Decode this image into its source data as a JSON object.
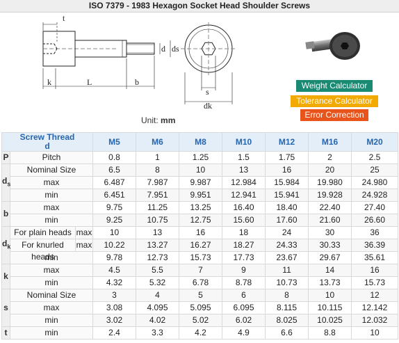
{
  "title": "ISO 7379 - 1983 Hexagon Socket Head Shoulder Screws",
  "drawing": {
    "dim_labels": [
      "t",
      "k",
      "L",
      "b",
      "d",
      "ds",
      "s",
      "dk"
    ]
  },
  "unit": {
    "label": "Unit:",
    "value": "mm"
  },
  "buttons": {
    "weight": "Weight Calculator",
    "tolerance": "Tolerance Calculator",
    "error": "Error Correction"
  },
  "colors": {
    "header_text": "#2765ad",
    "weight_btn": "#1a8a72",
    "tolerance_btn": "#f2a900",
    "error_btn": "#e8541c"
  },
  "table": {
    "header": {
      "label": "Screw Thread",
      "sub": "d"
    },
    "sizes": [
      "M5",
      "M6",
      "M8",
      "M10",
      "M12",
      "M16",
      "M20"
    ],
    "rows": [
      {
        "sym": "P",
        "label": "Pitch",
        "values": [
          "0.8",
          "1",
          "1.25",
          "1.5",
          "1.75",
          "2",
          "2.5"
        ]
      },
      {
        "sym": "ds",
        "label": "Nominal Size",
        "values": [
          "6.5",
          "8",
          "10",
          "13",
          "16",
          "20",
          "25"
        ]
      },
      {
        "label": "max",
        "values": [
          "6.487",
          "7.987",
          "9.987",
          "12.984",
          "15.984",
          "19.980",
          "24.980"
        ]
      },
      {
        "label": "min",
        "values": [
          "6.451",
          "7.951",
          "9.951",
          "12.941",
          "15.941",
          "19.928",
          "24.928"
        ]
      },
      {
        "sym": "b",
        "label": "max",
        "values": [
          "9.75",
          "11.25",
          "13.25",
          "16.40",
          "18.40",
          "22.40",
          "27.40"
        ]
      },
      {
        "label": "min",
        "values": [
          "9.25",
          "10.75",
          "12.75",
          "15.60",
          "17.60",
          "21.60",
          "26.60"
        ]
      },
      {
        "sym": "dk",
        "label": "For plain heads",
        "sub": "max",
        "values": [
          "10",
          "13",
          "16",
          "18",
          "24",
          "30",
          "36"
        ]
      },
      {
        "label": "For knurled heads",
        "sub": "max",
        "values": [
          "10.22",
          "13.27",
          "16.27",
          "18.27",
          "24.33",
          "30.33",
          "36.39"
        ]
      },
      {
        "label": "min",
        "values": [
          "9.78",
          "12.73",
          "15.73",
          "17.73",
          "23.67",
          "29.67",
          "35.61"
        ]
      },
      {
        "sym": "k",
        "label": "max",
        "values": [
          "4.5",
          "5.5",
          "7",
          "9",
          "11",
          "14",
          "16"
        ]
      },
      {
        "label": "min",
        "values": [
          "4.32",
          "5.32",
          "6.78",
          "8.78",
          "10.73",
          "13.73",
          "15.73"
        ]
      },
      {
        "sym": "s",
        "label": "Nominal Size",
        "values": [
          "3",
          "4",
          "5",
          "6",
          "8",
          "10",
          "12"
        ]
      },
      {
        "label": "max",
        "values": [
          "3.08",
          "4.095",
          "5.095",
          "6.095",
          "8.115",
          "10.115",
          "12.142"
        ]
      },
      {
        "label": "min",
        "values": [
          "3.02",
          "4.02",
          "5.02",
          "6.02",
          "8.025",
          "10.025",
          "12.032"
        ]
      },
      {
        "sym": "t",
        "label": "min",
        "values": [
          "2.4",
          "3.3",
          "4.2",
          "4.9",
          "6.6",
          "8.8",
          "10"
        ]
      }
    ]
  }
}
